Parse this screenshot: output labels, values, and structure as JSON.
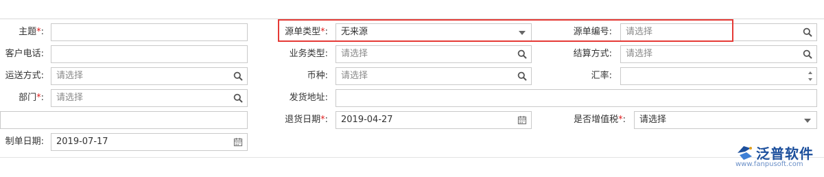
{
  "form": {
    "subject_label": "主题",
    "customer_phone_label": "客户电话:",
    "shipping_method_label": "运送方式:",
    "shipping_method_placeholder": "请选择",
    "department_label": "部门",
    "department_placeholder": "请选择",
    "created_date_label": "制单日期:",
    "created_date_value": "2019-07-17",
    "source_type_label": "源单类型",
    "source_type_value": "无来源",
    "business_type_label": "业务类型:",
    "business_type_placeholder": "请选择",
    "currency_label": "币种:",
    "currency_placeholder": "请选择",
    "shipping_address_label": "发货地址:",
    "return_date_label": "退货日期",
    "return_date_value": "2019-04-27",
    "source_no_label": "源单编号:",
    "source_no_placeholder": "请选择",
    "settlement_label": "结算方式:",
    "settlement_placeholder": "请选择",
    "exchange_rate_label": "汇率:",
    "vat_label": "是否增值税",
    "vat_placeholder": "请选择",
    "required_mark": "*",
    "colon": ":"
  },
  "watermark": {
    "brand": "泛普软件",
    "url": "www.fanpusoft.com"
  },
  "colors": {
    "highlight": "#e53935",
    "required": "#e02020",
    "brand": "#1c4f9c"
  }
}
